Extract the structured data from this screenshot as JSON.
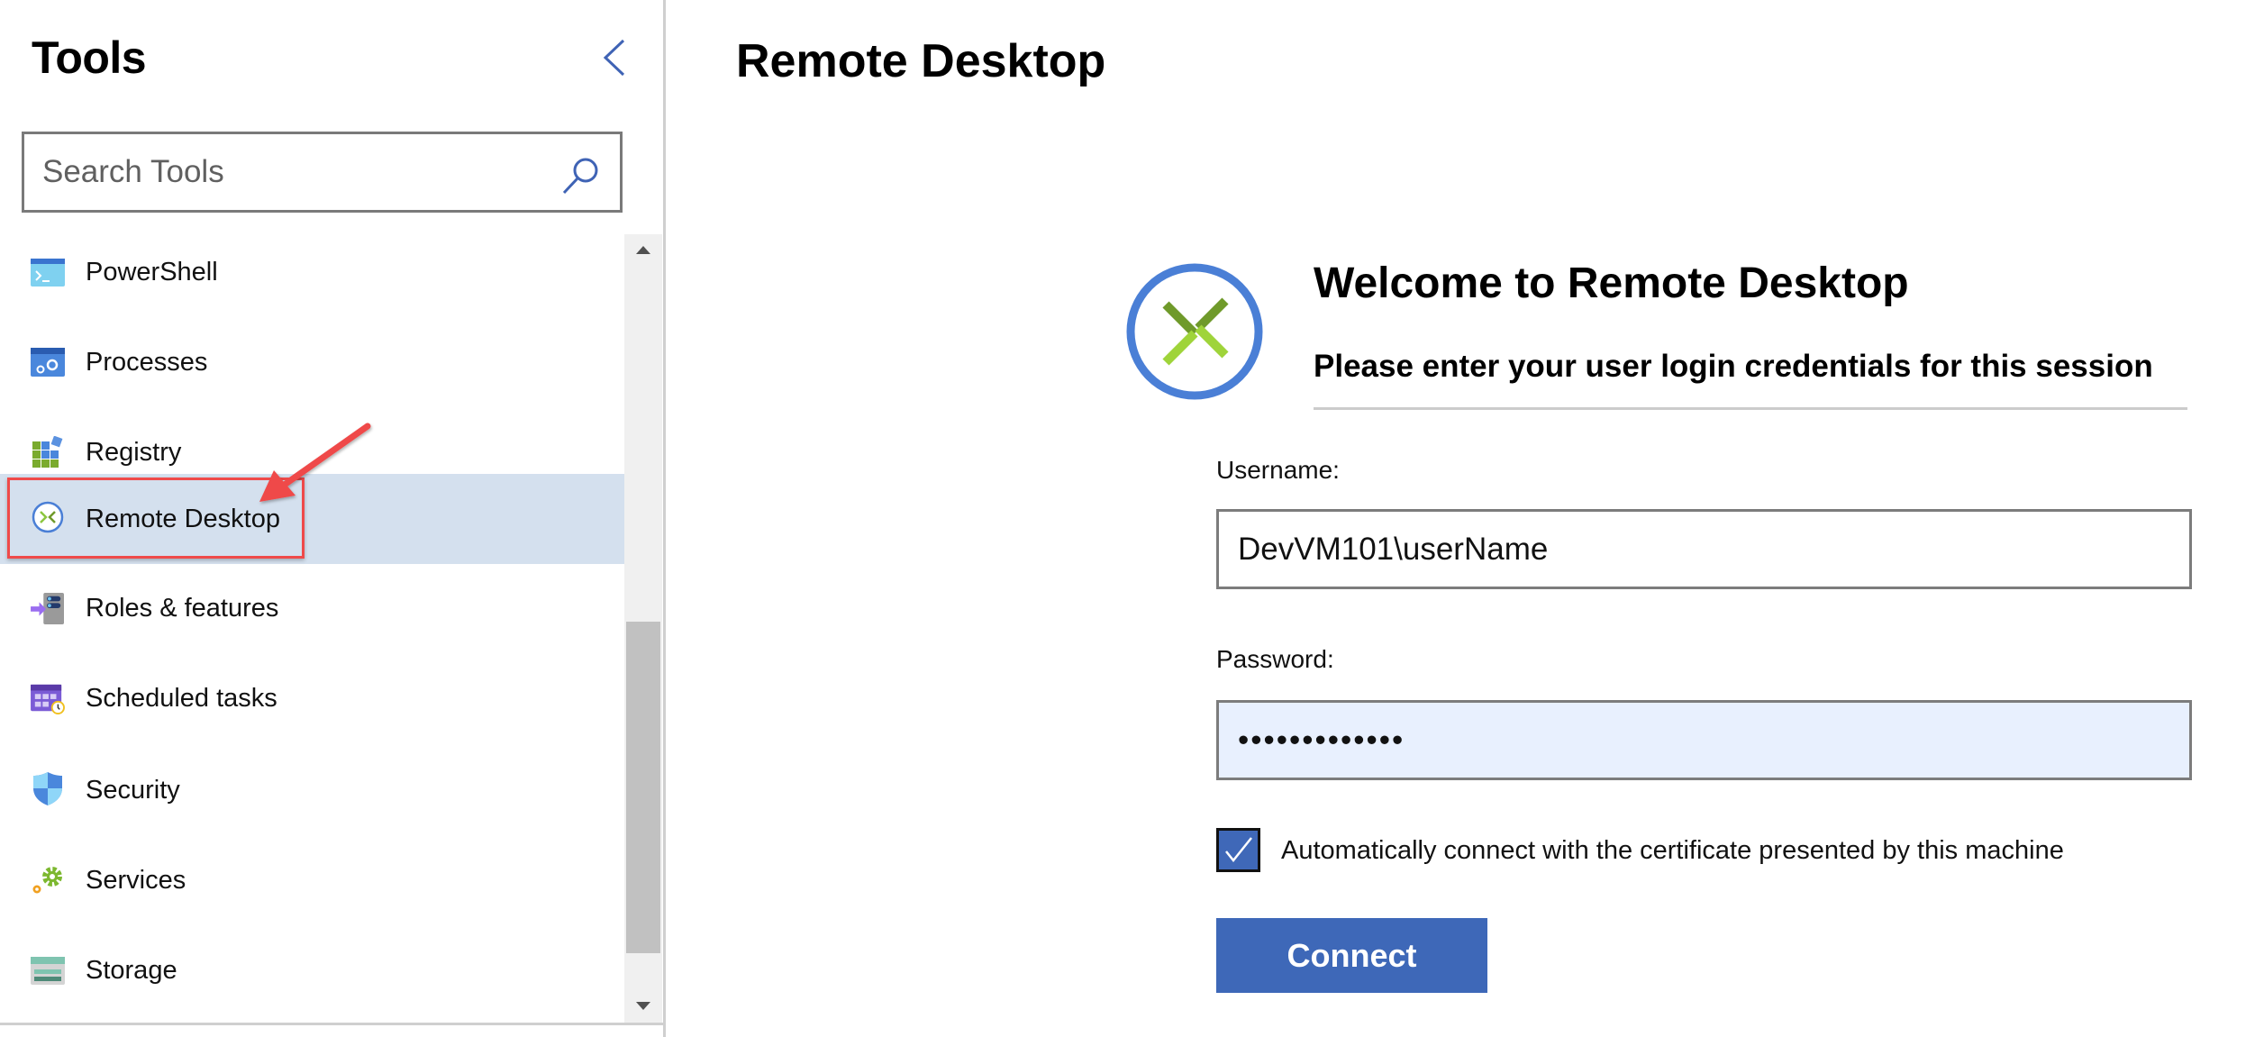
{
  "sidebar": {
    "title": "Tools",
    "collapse_icon": "chevron-left-icon",
    "search": {
      "placeholder": "Search Tools",
      "value": "",
      "icon": "search-icon"
    },
    "items": [
      {
        "label": "PowerShell",
        "icon": "powershell-icon",
        "selected": false
      },
      {
        "label": "Processes",
        "icon": "processes-icon",
        "selected": false
      },
      {
        "label": "Registry",
        "icon": "registry-icon",
        "selected": false
      },
      {
        "label": "Remote Desktop",
        "icon": "remote-desktop-icon",
        "selected": true
      },
      {
        "label": "Roles & features",
        "icon": "roles-features-icon",
        "selected": false
      },
      {
        "label": "Scheduled tasks",
        "icon": "scheduled-tasks-icon",
        "selected": false
      },
      {
        "label": "Security",
        "icon": "security-shield-icon",
        "selected": false
      },
      {
        "label": "Services",
        "icon": "services-gear-icon",
        "selected": false
      },
      {
        "label": "Storage",
        "icon": "storage-icon",
        "selected": false
      }
    ]
  },
  "main": {
    "page_title": "Remote Desktop",
    "welcome_title": "Welcome to Remote Desktop",
    "welcome_subtitle": "Please enter your user login credentials for this session",
    "username": {
      "label": "Username:",
      "value": "DevVM101\\userName"
    },
    "password": {
      "label": "Password:",
      "value": "•••••••••••••"
    },
    "auto_connect": {
      "label": "Automatically connect with the certificate presented by this machine",
      "checked": true
    },
    "connect_label": "Connect"
  },
  "colors": {
    "accent": "#3e68b8",
    "selected_row": "#d4e0ee",
    "password_field_bg": "#e8f0fe",
    "annotation_red": "#ef4a4a",
    "logo_ring": "#4a7fd6",
    "logo_green_dark": "#6f9a2a",
    "logo_green_light": "#9fd43a"
  }
}
